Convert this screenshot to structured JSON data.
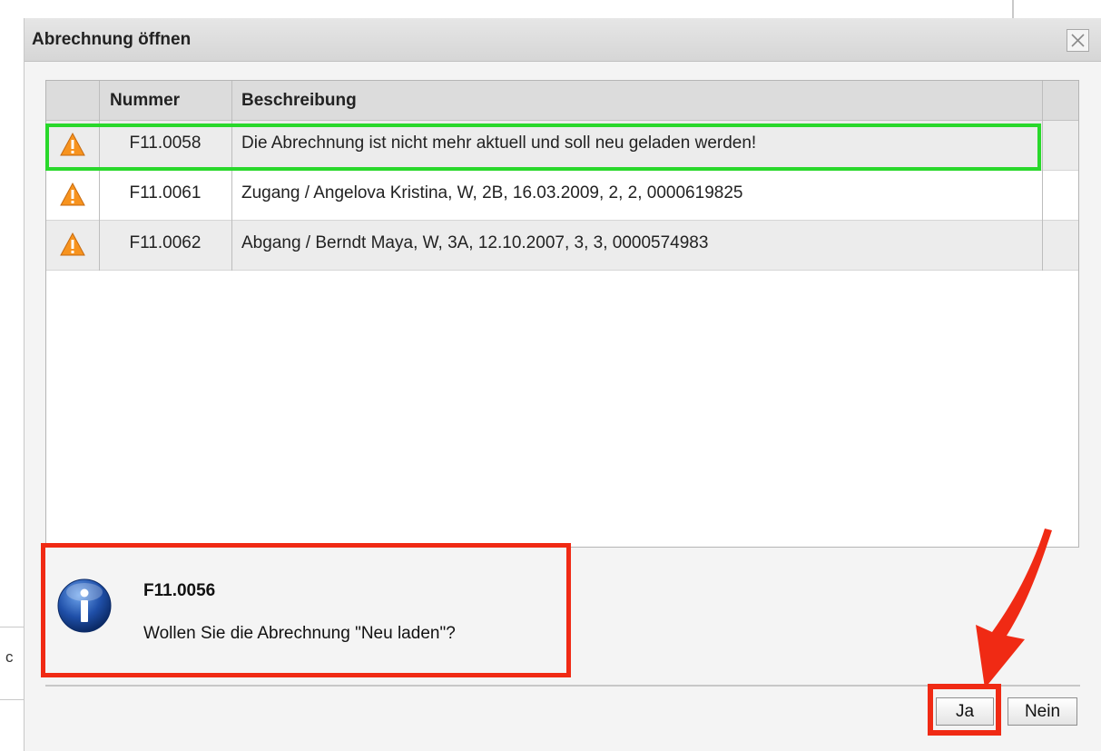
{
  "dialog": {
    "title": "Abrechnung öffnen",
    "close_icon": "close-x-icon"
  },
  "table": {
    "columns": [
      "",
      "Nummer",
      "Beschreibung"
    ],
    "rows": [
      {
        "icon": "warning-icon",
        "nummer": "F11.0058",
        "beschreibung": "Die Abrechnung ist nicht mehr aktuell und soll neu geladen werden!"
      },
      {
        "icon": "warning-icon",
        "nummer": "F11.0061",
        "beschreibung": "Zugang / Angelova Kristina, W, 2B, 16.03.2009, 2, 2, 0000619825"
      },
      {
        "icon": "warning-icon",
        "nummer": "F11.0062",
        "beschreibung": "Abgang / Berndt Maya, W, 3A, 12.10.2007, 3, 3, 0000574983"
      }
    ]
  },
  "info": {
    "icon": "info-icon",
    "code": "F11.0056",
    "message": "Wollen Sie die Abrechnung \"Neu laden\"?"
  },
  "buttons": {
    "yes_label": "Ja",
    "no_label": "Nein"
  },
  "background": {
    "stray_char": "c"
  },
  "colors": {
    "highlight_green": "#29d82b",
    "highlight_red": "#f02a14",
    "warning_orange": "#f7931e",
    "info_blue": "#1f4fa8"
  }
}
